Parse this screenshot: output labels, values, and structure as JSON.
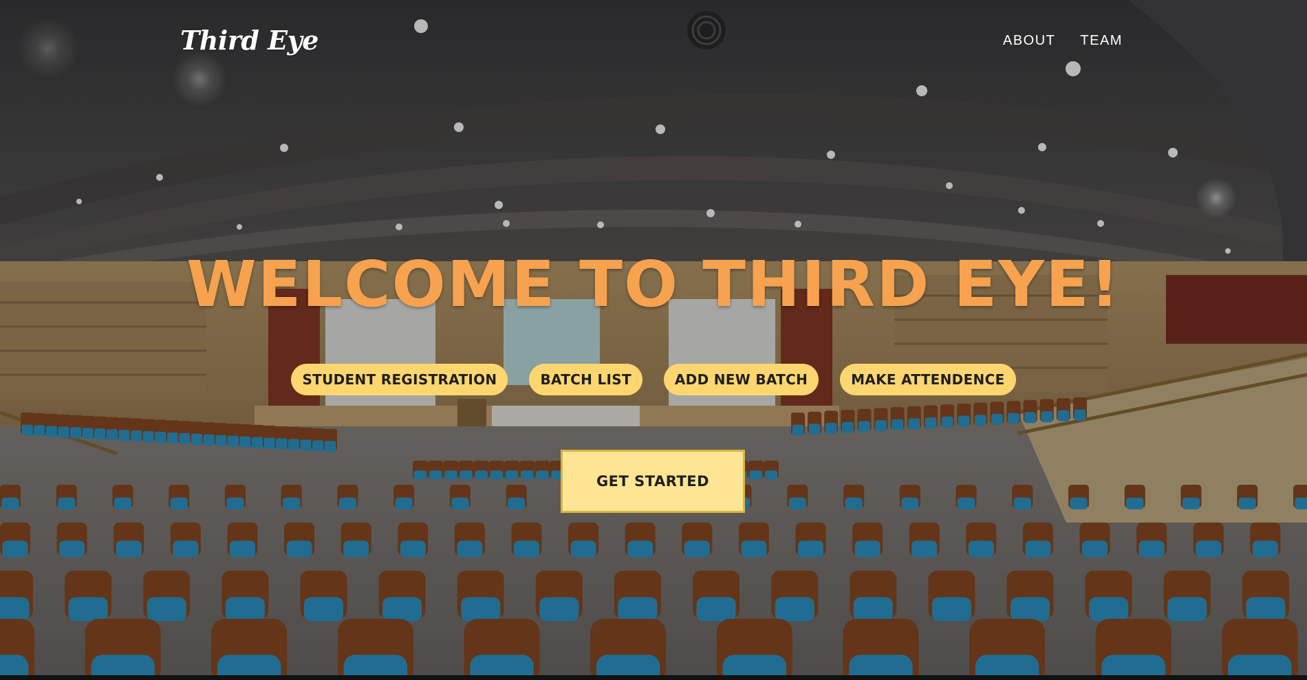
{
  "brand": {
    "logo_text": "Third Eye"
  },
  "nav": {
    "links": [
      {
        "label": "ABOUT"
      },
      {
        "label": "TEAM"
      }
    ]
  },
  "hero": {
    "headline": "WELCOME TO THIRD EYE!",
    "actions": [
      {
        "label": "STUDENT REGISTRATION"
      },
      {
        "label": "BATCH LIST"
      },
      {
        "label": "ADD NEW BATCH"
      },
      {
        "label": "MAKE ATTENDENCE"
      }
    ],
    "cta_label": "GET STARTED",
    "background": "auditorium-photo"
  },
  "colors": {
    "headline": "#f7a24f",
    "pill": "#fdd670",
    "cta": "#fee594",
    "cta_border": "#d9b440",
    "nav_text": "#ffffff"
  }
}
